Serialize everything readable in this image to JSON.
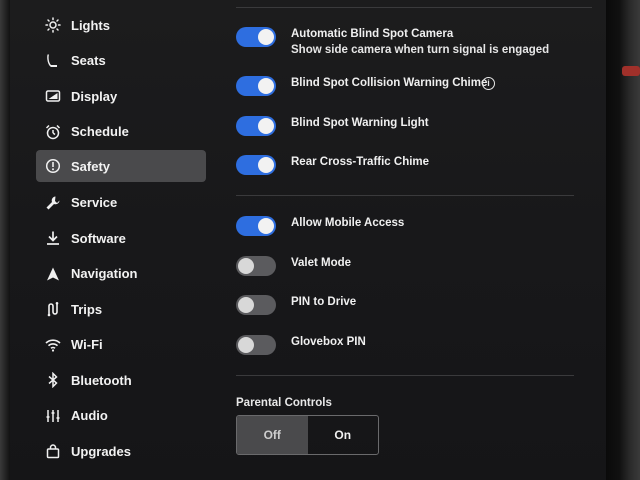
{
  "sidebar": {
    "items": [
      {
        "label": "Lights",
        "icon": "sun-icon"
      },
      {
        "label": "Seats",
        "icon": "seat-icon"
      },
      {
        "label": "Display",
        "icon": "display-icon"
      },
      {
        "label": "Schedule",
        "icon": "alarm-clock-icon"
      },
      {
        "label": "Safety",
        "icon": "alert-circle-icon",
        "active": true
      },
      {
        "label": "Service",
        "icon": "wrench-icon"
      },
      {
        "label": "Software",
        "icon": "download-icon"
      },
      {
        "label": "Navigation",
        "icon": "navigation-arrow-icon"
      },
      {
        "label": "Trips",
        "icon": "trips-icon"
      },
      {
        "label": "Wi-Fi",
        "icon": "wifi-icon"
      },
      {
        "label": "Bluetooth",
        "icon": "bluetooth-icon"
      },
      {
        "label": "Audio",
        "icon": "equalizer-icon"
      },
      {
        "label": "Upgrades",
        "icon": "shopping-bag-icon"
      }
    ]
  },
  "settings": {
    "blind_spot_camera": {
      "label": "Automatic Blind Spot Camera",
      "sub": "Show side camera when turn signal is engaged",
      "on": true
    },
    "collision_chime": {
      "label": "Blind Spot Collision Warning Chime",
      "on": true,
      "info_icon": "info-icon"
    },
    "warning_light": {
      "label": "Blind Spot Warning Light",
      "on": true
    },
    "rear_cross_traffic": {
      "label": "Rear Cross-Traffic Chime",
      "on": true
    },
    "mobile_access": {
      "label": "Allow Mobile Access",
      "on": true
    },
    "valet_mode": {
      "label": "Valet Mode",
      "on": false
    },
    "pin_to_drive": {
      "label": "PIN to Drive",
      "on": false
    },
    "glovebox_pin": {
      "label": "Glovebox PIN",
      "on": false
    }
  },
  "parental_controls": {
    "title": "Parental Controls",
    "options": [
      "Off",
      "On"
    ],
    "selected": "Off"
  },
  "colors": {
    "toggle_on": "#2e6ee0",
    "toggle_off": "#5b5b5e",
    "active_item_bg": "#4a4a4c"
  }
}
